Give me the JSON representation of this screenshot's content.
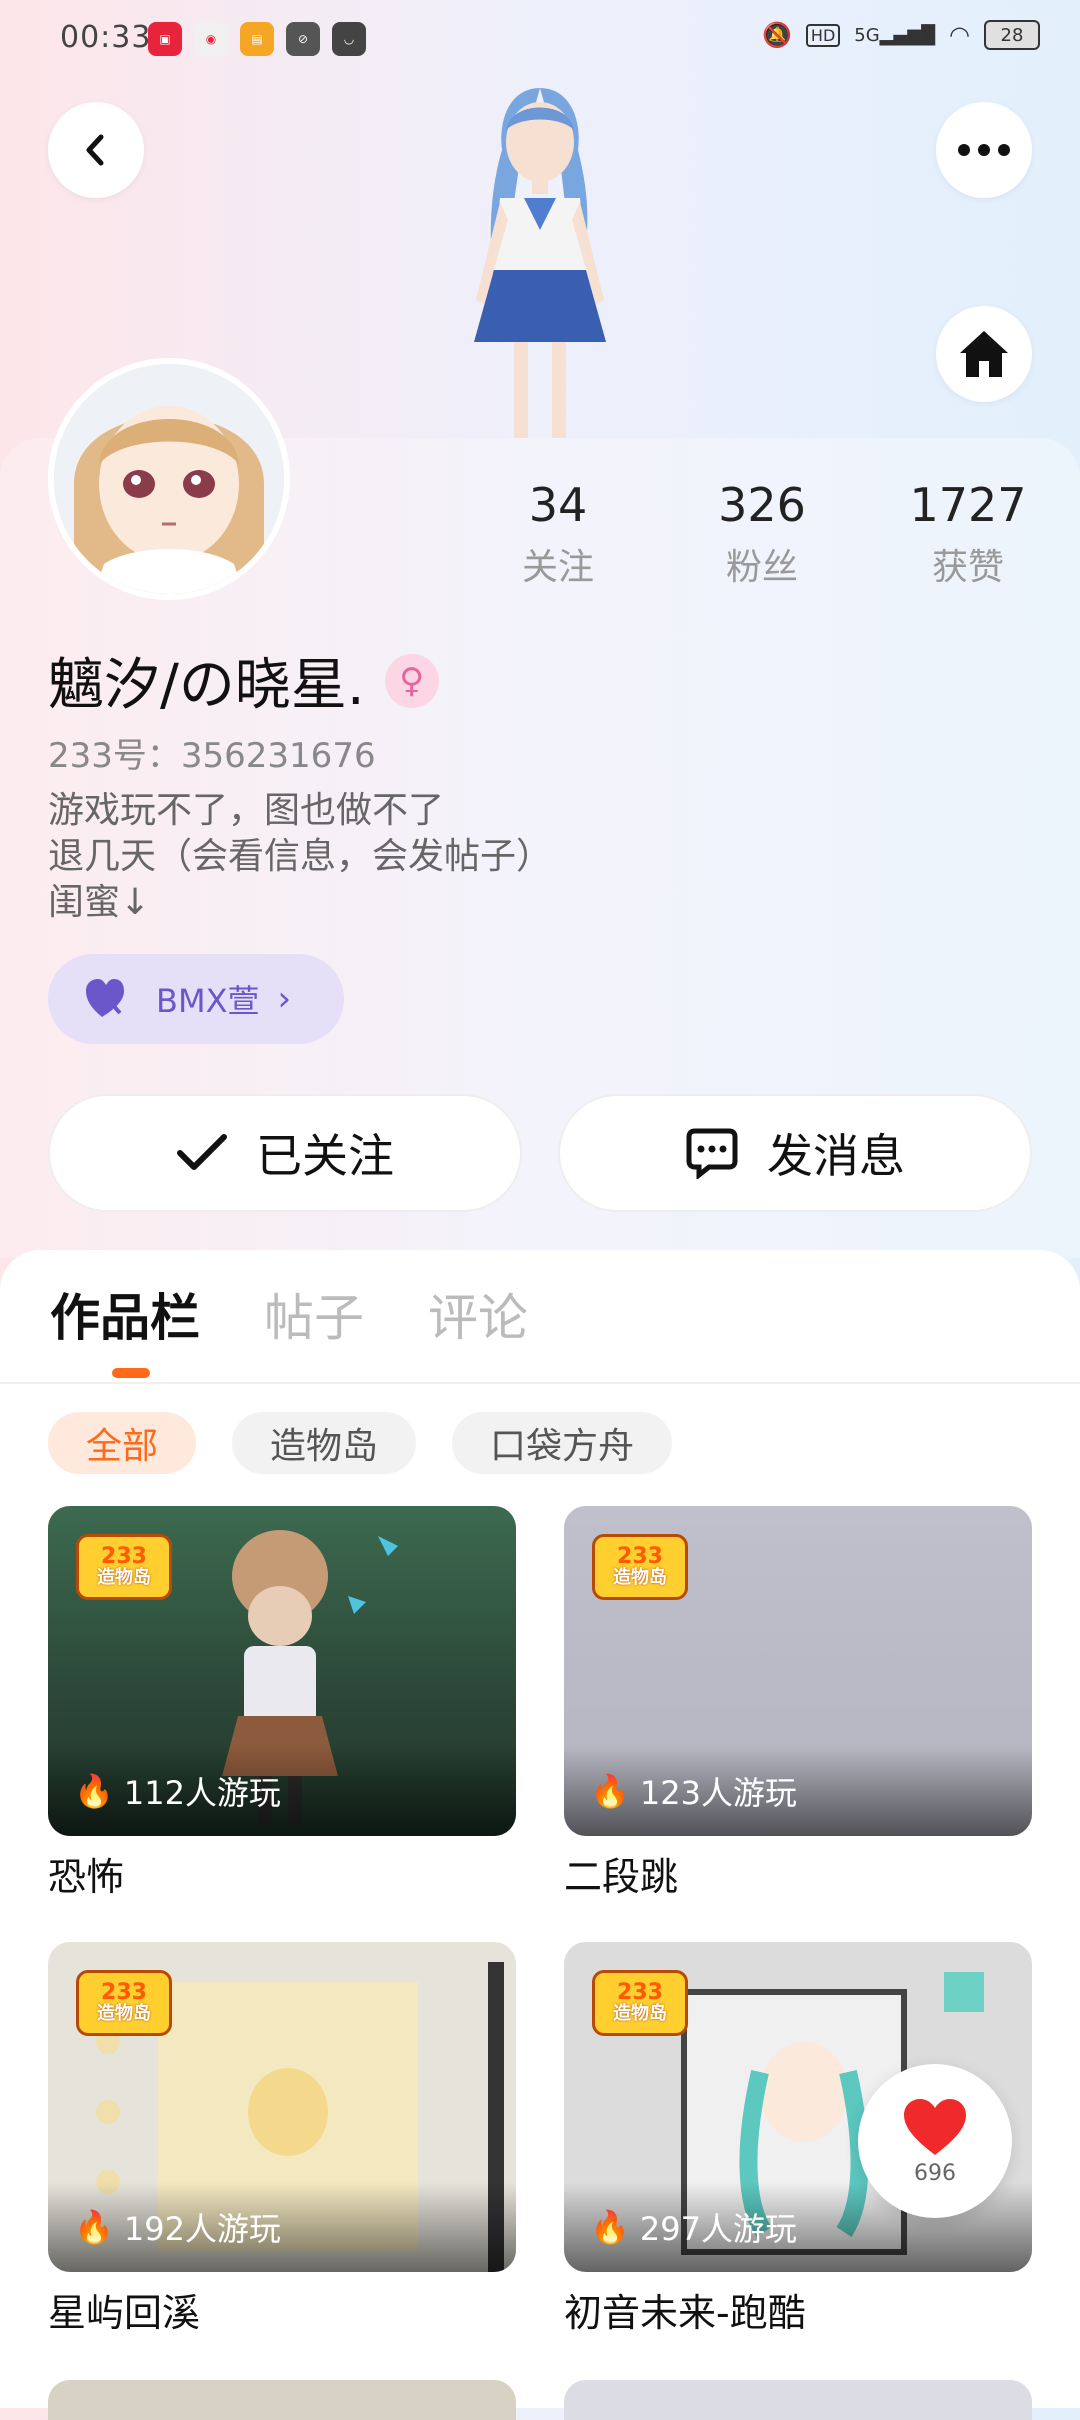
{
  "status_bar": {
    "time": "00:33",
    "network": "5G",
    "hd": "HD",
    "battery": "28"
  },
  "profile": {
    "stats": [
      {
        "value": "34",
        "label": "关注"
      },
      {
        "value": "326",
        "label": "粉丝"
      },
      {
        "value": "1727",
        "label": "获赞"
      }
    ],
    "name": "魑汐/の晓星.",
    "gender_symbol": "♀",
    "uid": "233号：356231676",
    "bio": [
      "游戏玩不了，图也做不了",
      "退几天（会看信息，会发帖子）",
      "闺蜜↓"
    ],
    "tag_label": "BMX萱"
  },
  "actions": {
    "follow_label": "已关注",
    "message_label": "发消息"
  },
  "tabs": [
    {
      "label": "作品栏",
      "active": true
    },
    {
      "label": "帖子",
      "active": false
    },
    {
      "label": "评论",
      "active": false
    }
  ],
  "filters": [
    {
      "label": "全部",
      "active": true
    },
    {
      "label": "造物岛",
      "active": false
    },
    {
      "label": "口袋方舟",
      "active": false
    }
  ],
  "badge": {
    "line1": "233",
    "line2": "造物岛"
  },
  "works": [
    {
      "title": "恐怖",
      "plays": "112人游玩"
    },
    {
      "title": "二段跳",
      "plays": "123人游玩"
    },
    {
      "title": "星屿回溪",
      "plays": "192人游玩"
    },
    {
      "title": "初音未来-跑酷",
      "plays": "297人游玩"
    }
  ],
  "like": {
    "count": "696"
  },
  "colors": {
    "accent": "#ff6a1a",
    "tag": "#6b57c9"
  }
}
